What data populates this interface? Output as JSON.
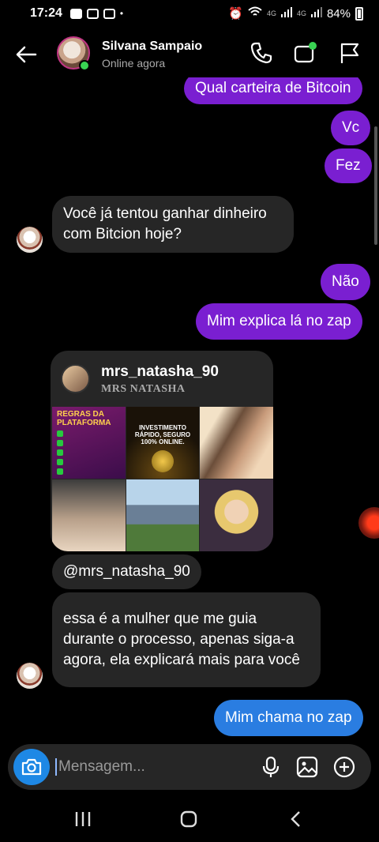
{
  "status_bar": {
    "time": "17:24",
    "network_label_1": "4G",
    "network_label_2": "4G",
    "battery": "84%"
  },
  "header": {
    "contact_name": "Silvana Sampaio",
    "contact_status": "Online agora"
  },
  "messages": [
    {
      "side": "out",
      "text": "Qual carteira de Bitcoin"
    },
    {
      "side": "out",
      "text": "Vc"
    },
    {
      "side": "out",
      "text": "Fez"
    },
    {
      "side": "in",
      "text": "Você já tentou ganhar dinheiro com Bitcion hoje?"
    },
    {
      "side": "out",
      "text": "Não"
    },
    {
      "side": "out",
      "text": "Mim explica lá no zap"
    },
    {
      "side": "in",
      "text": "@mrs_natasha_90"
    },
    {
      "side": "in",
      "text": "essa é a mulher que me guia durante o processo, apenas siga-a agora, ela explicará mais para você"
    },
    {
      "side": "out",
      "text": "Mim chama no zap"
    }
  ],
  "shared_profile": {
    "username": "mrs_natasha_90",
    "display_name": "MRS NATASHA",
    "tile1_title": "REGRAS DA PLATAFORMA",
    "tile2_title": "INVESTIMENTO RÁPIDO, SEGURO 100% ONLINE."
  },
  "input": {
    "placeholder": "Mensagem..."
  },
  "colors": {
    "outgoing_bubble": "#7a1fd1",
    "outgoing_last_bubble": "#2a7de1",
    "incoming_bubble": "#262626",
    "online_dot": "#39d353"
  },
  "icons": {
    "header": [
      "back-arrow-icon",
      "phone-icon",
      "video-call-icon",
      "flag-icon"
    ],
    "input": [
      "camera-icon",
      "microphone-icon",
      "gallery-icon",
      "add-circle-icon"
    ],
    "nav": [
      "recent-apps-icon",
      "home-icon",
      "back-nav-icon"
    ]
  }
}
